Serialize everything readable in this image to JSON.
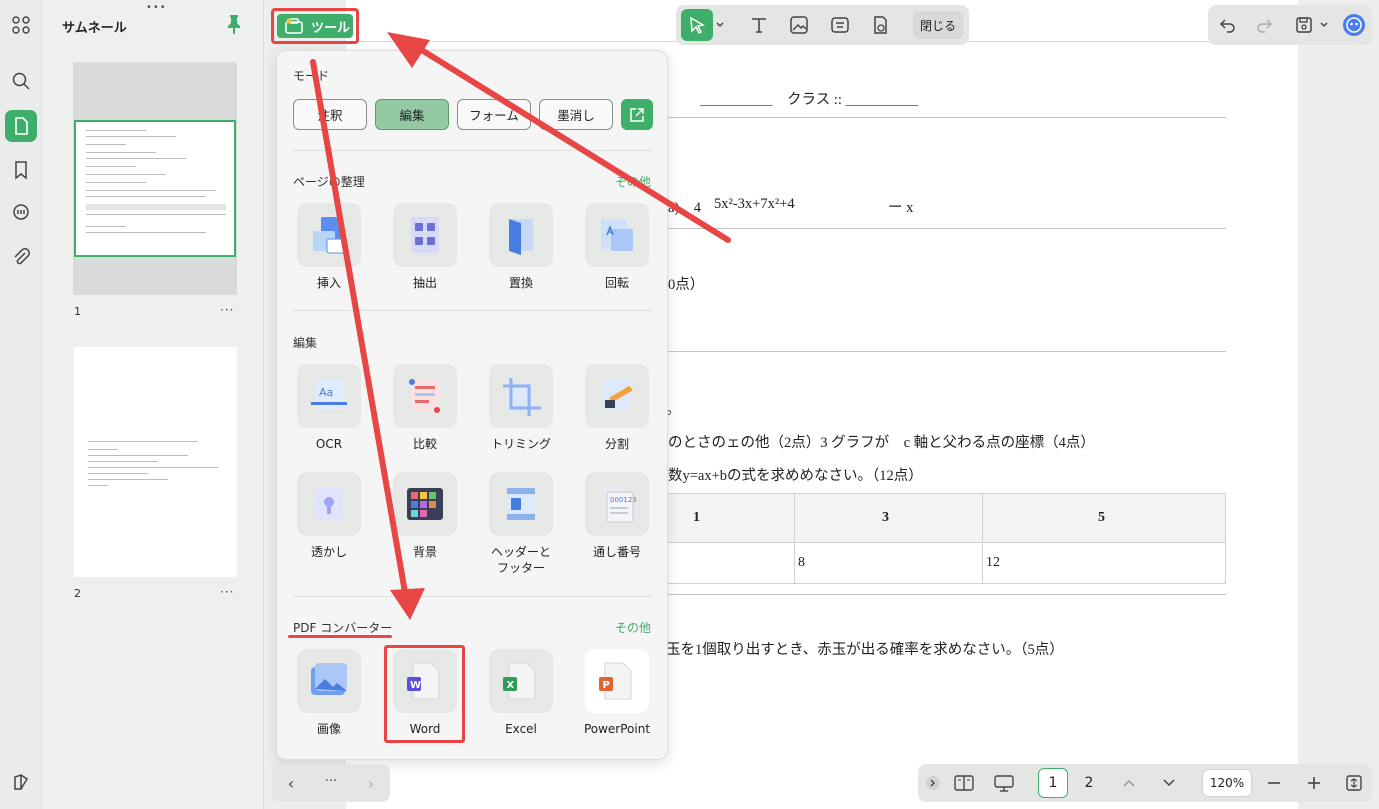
{
  "sidebar": {
    "title": "サムネール",
    "thumbnails": [
      {
        "page": "1",
        "more": "···"
      },
      {
        "page": "2",
        "more": "···"
      }
    ]
  },
  "toolbar": {
    "tools_label": "ツール",
    "close_label": "閉じる"
  },
  "panel": {
    "mode_title": "モード",
    "modes": [
      "注釈",
      "編集",
      "フォーム",
      "墨消し"
    ],
    "page_section": {
      "title": "ページの整理",
      "more": "その他"
    },
    "page_tools": [
      "挿入",
      "抽出",
      "置換",
      "回転"
    ],
    "edit_section": {
      "title": "編集"
    },
    "edit_tools": [
      "OCR",
      "比較",
      "トリミング",
      "分割",
      "透かし",
      "背景",
      "ヘッダーと\nフッター",
      "通し番号"
    ],
    "convert_section": {
      "title": "PDF コンバーター",
      "more": "その他"
    },
    "convert_tools": [
      "画像",
      "Word",
      "Excel",
      "PowerPoint"
    ]
  },
  "document": {
    "line1": "＿＿＿＿＿　クラス ::  ＿＿＿＿＿",
    "line2a": "a)　4",
    "line2b": "5x²-3x+7x²+4",
    "line2c": "ー x",
    "line3": "0点）",
    "line4": "。",
    "line5": "のとさのェの他（2点）3 グラフが　c 軸と父わる点の座標（4点）",
    "line6": "数y=ax+bの式を求めめなさい。（12点）",
    "table_header": [
      "1",
      "3",
      "5"
    ],
    "table_row": [
      "",
      "8",
      "12"
    ],
    "line7": "玉を1個取り出すとき、赤玉が出る確率を求めなさい。（5点）"
  },
  "bottom": {
    "nav_more": "···",
    "pages": [
      "1",
      "2"
    ],
    "zoom": "120%"
  }
}
